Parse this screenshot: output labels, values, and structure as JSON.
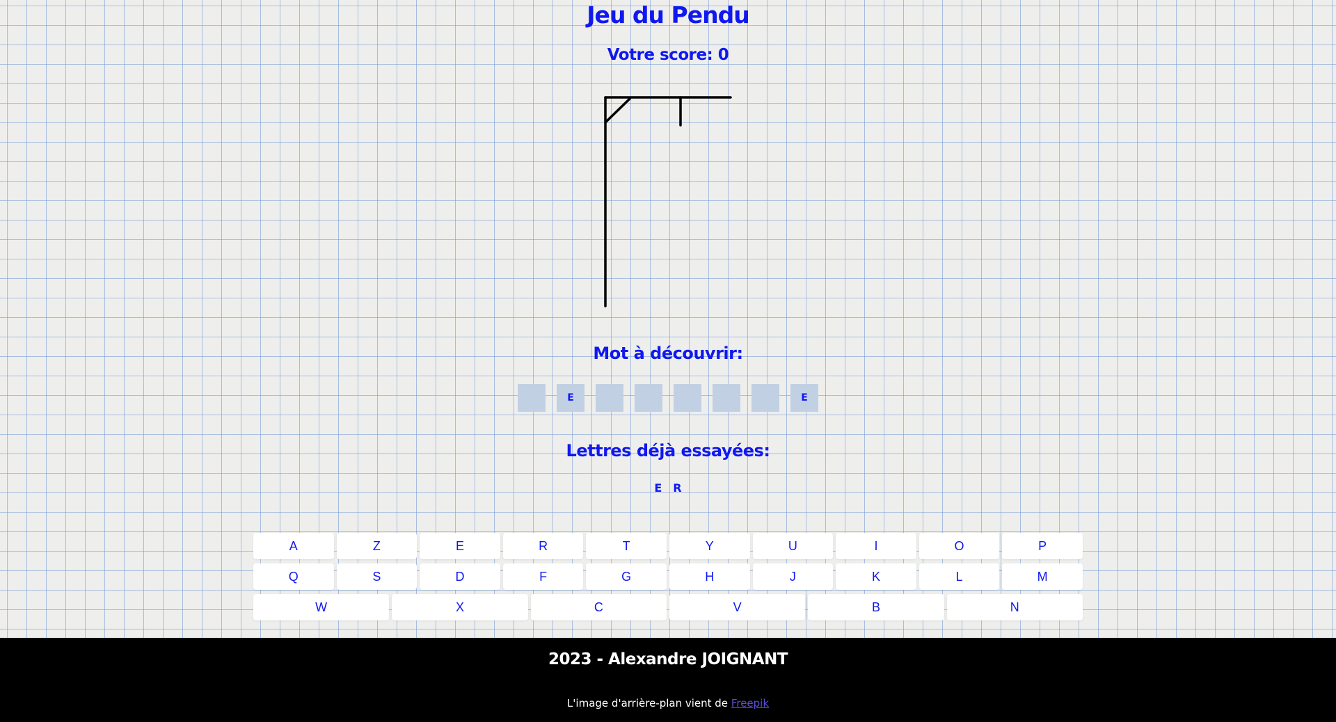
{
  "header": {
    "title": "Jeu du Pendu",
    "score_label": "Votre score: 0"
  },
  "word_section": {
    "title": "Mot à découvrir:",
    "slots": [
      "",
      "E",
      "",
      "",
      "",
      "",
      "",
      "E"
    ]
  },
  "tried_section": {
    "title": "Lettres déjà essayées:",
    "letters": [
      "E",
      "R"
    ]
  },
  "keyboard": {
    "rows": [
      [
        "A",
        "Z",
        "E",
        "R",
        "T",
        "Y",
        "U",
        "I",
        "O",
        "P"
      ],
      [
        "Q",
        "S",
        "D",
        "F",
        "G",
        "H",
        "J",
        "K",
        "L",
        "M"
      ],
      [
        "W",
        "X",
        "C",
        "V",
        "B",
        "N"
      ]
    ]
  },
  "footer": {
    "credit": "2023 - Alexandre JOIGNANT",
    "bg_note": "L'image d'arrière-plan vient de",
    "bg_link": "Freepik"
  },
  "colors": {
    "accent": "#1018f0",
    "slot_bg": "#c2d0e4",
    "footer_bg": "#000000"
  },
  "icons": {
    "gallows": "hangman-gallows-drawing"
  }
}
